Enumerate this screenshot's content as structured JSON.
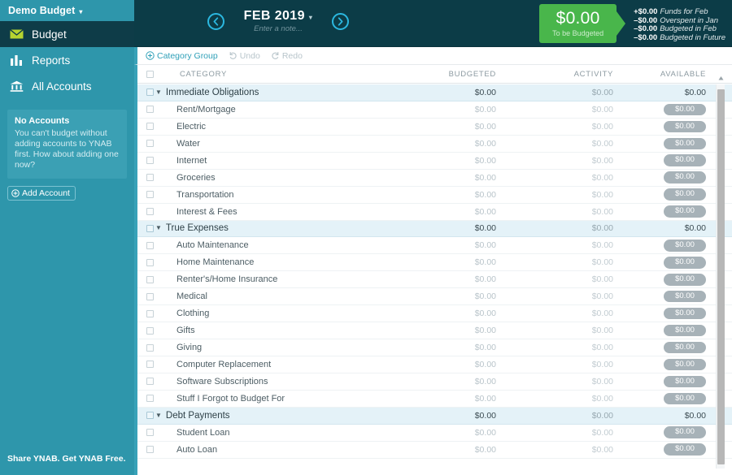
{
  "sidebar": {
    "budget_name": "Demo Budget",
    "budget_caret": "▾",
    "nav": [
      {
        "label": "Budget",
        "icon": "envelope-icon",
        "active": true
      },
      {
        "label": "Reports",
        "icon": "bar-chart-icon",
        "active": false
      },
      {
        "label": "All Accounts",
        "icon": "bank-icon",
        "active": false
      }
    ],
    "accounts_box": {
      "title": "No Accounts",
      "text": "You can't budget without adding accounts to YNAB first. How about adding one now?"
    },
    "add_account_label": "Add Account",
    "share_label": "Share YNAB. Get YNAB Free."
  },
  "header": {
    "prev_icon": "chevron-left-icon",
    "next_icon": "chevron-right-icon",
    "month": "FEB 2019",
    "month_caret": "▾",
    "note_placeholder": "Enter a note...",
    "to_be_budgeted": {
      "amount": "$0.00",
      "caption": "To be Budgeted",
      "color": "#49b64b",
      "breakdown": [
        {
          "value": "+$0.00",
          "label": "Funds for Feb"
        },
        {
          "value": "–$0.00",
          "label": "Overspent in Jan"
        },
        {
          "value": "–$0.00",
          "label": "Budgeted in Feb"
        },
        {
          "value": "–$0.00",
          "label": "Budgeted in Future"
        }
      ]
    }
  },
  "toolbar": {
    "category_group_label": "Category Group",
    "undo_label": "Undo",
    "redo_label": "Redo"
  },
  "table": {
    "columns": {
      "category": "CATEGORY",
      "budgeted": "BUDGETED",
      "activity": "ACTIVITY",
      "available": "AVAILABLE"
    },
    "groups": [
      {
        "name": "Immediate Obligations",
        "budgeted": "$0.00",
        "activity": "$0.00",
        "available": "$0.00",
        "categories": [
          {
            "name": "Rent/Mortgage",
            "budgeted": "$0.00",
            "activity": "$0.00",
            "available": "$0.00"
          },
          {
            "name": "Electric",
            "budgeted": "$0.00",
            "activity": "$0.00",
            "available": "$0.00"
          },
          {
            "name": "Water",
            "budgeted": "$0.00",
            "activity": "$0.00",
            "available": "$0.00"
          },
          {
            "name": "Internet",
            "budgeted": "$0.00",
            "activity": "$0.00",
            "available": "$0.00"
          },
          {
            "name": "Groceries",
            "budgeted": "$0.00",
            "activity": "$0.00",
            "available": "$0.00"
          },
          {
            "name": "Transportation",
            "budgeted": "$0.00",
            "activity": "$0.00",
            "available": "$0.00"
          },
          {
            "name": "Interest & Fees",
            "budgeted": "$0.00",
            "activity": "$0.00",
            "available": "$0.00"
          }
        ]
      },
      {
        "name": "True Expenses",
        "budgeted": "$0.00",
        "activity": "$0.00",
        "available": "$0.00",
        "categories": [
          {
            "name": "Auto Maintenance",
            "budgeted": "$0.00",
            "activity": "$0.00",
            "available": "$0.00"
          },
          {
            "name": "Home Maintenance",
            "budgeted": "$0.00",
            "activity": "$0.00",
            "available": "$0.00"
          },
          {
            "name": "Renter's/Home Insurance",
            "budgeted": "$0.00",
            "activity": "$0.00",
            "available": "$0.00"
          },
          {
            "name": "Medical",
            "budgeted": "$0.00",
            "activity": "$0.00",
            "available": "$0.00"
          },
          {
            "name": "Clothing",
            "budgeted": "$0.00",
            "activity": "$0.00",
            "available": "$0.00"
          },
          {
            "name": "Gifts",
            "budgeted": "$0.00",
            "activity": "$0.00",
            "available": "$0.00"
          },
          {
            "name": "Giving",
            "budgeted": "$0.00",
            "activity": "$0.00",
            "available": "$0.00"
          },
          {
            "name": "Computer Replacement",
            "budgeted": "$0.00",
            "activity": "$0.00",
            "available": "$0.00"
          },
          {
            "name": "Software Subscriptions",
            "budgeted": "$0.00",
            "activity": "$0.00",
            "available": "$0.00"
          },
          {
            "name": "Stuff I Forgot to Budget For",
            "budgeted": "$0.00",
            "activity": "$0.00",
            "available": "$0.00"
          }
        ]
      },
      {
        "name": "Debt Payments",
        "budgeted": "$0.00",
        "activity": "$0.00",
        "available": "$0.00",
        "categories": [
          {
            "name": "Student Loan",
            "budgeted": "$0.00",
            "activity": "$0.00",
            "available": "$0.00"
          },
          {
            "name": "Auto Loan",
            "budgeted": "$0.00",
            "activity": "$0.00",
            "available": "$0.00"
          }
        ]
      }
    ],
    "collapse_caret": "▼"
  }
}
